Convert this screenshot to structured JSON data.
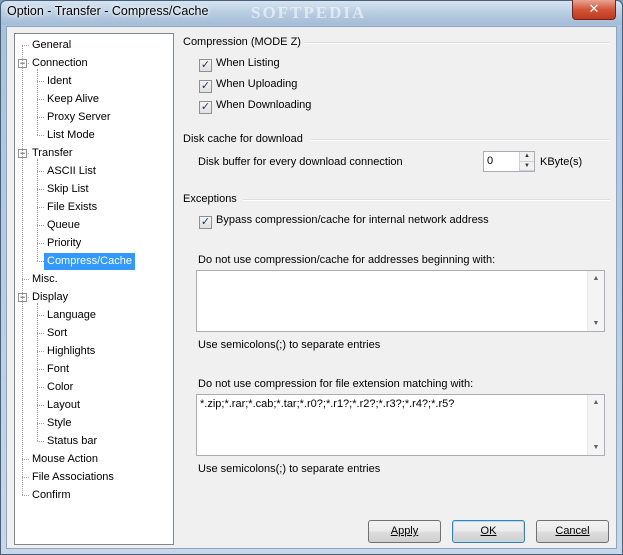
{
  "window": {
    "title": "Option - Transfer - Compress/Cache",
    "watermark": "SOFTPEDIA",
    "close_glyph": "✕"
  },
  "tree": {
    "items": [
      {
        "label": "General",
        "level": 0
      },
      {
        "label": "Connection",
        "level": 0,
        "toggle": "−"
      },
      {
        "label": "Ident",
        "level": 1
      },
      {
        "label": "Keep Alive",
        "level": 1
      },
      {
        "label": "Proxy Server",
        "level": 1
      },
      {
        "label": "List Mode",
        "level": 1
      },
      {
        "label": "Transfer",
        "level": 0,
        "toggle": "−"
      },
      {
        "label": "ASCII List",
        "level": 1
      },
      {
        "label": "Skip List",
        "level": 1
      },
      {
        "label": "File Exists",
        "level": 1
      },
      {
        "label": "Queue",
        "level": 1
      },
      {
        "label": "Priority",
        "level": 1
      },
      {
        "label": "Compress/Cache",
        "level": 1,
        "selected": true
      },
      {
        "label": "Misc.",
        "level": 0
      },
      {
        "label": "Display",
        "level": 0,
        "toggle": "−"
      },
      {
        "label": "Language",
        "level": 1
      },
      {
        "label": "Sort",
        "level": 1
      },
      {
        "label": "Highlights",
        "level": 1
      },
      {
        "label": "Font",
        "level": 1
      },
      {
        "label": "Color",
        "level": 1
      },
      {
        "label": "Layout",
        "level": 1
      },
      {
        "label": "Style",
        "level": 1
      },
      {
        "label": "Status bar",
        "level": 1
      },
      {
        "label": "Mouse Action",
        "level": 0
      },
      {
        "label": "File Associations",
        "level": 0
      },
      {
        "label": "Confirm",
        "level": 0
      }
    ]
  },
  "compression": {
    "title": "Compression (MODE Z)",
    "when_listing": "When Listing",
    "when_uploading": "When Uploading",
    "when_downloading": "When Downloading",
    "check_glyph": "✓"
  },
  "disk_cache": {
    "title": "Disk cache for download",
    "buffer_label": "Disk buffer for every download connection",
    "buffer_value": "0",
    "unit": "KByte(s)",
    "up_glyph": "▲",
    "down_glyph": "▼"
  },
  "exceptions": {
    "title": "Exceptions",
    "bypass_label": "Bypass compression/cache for internal network address",
    "addresses_label": "Do not use compression/cache for addresses beginning with:",
    "addresses_value": "",
    "addresses_hint": "Use semicolons(;) to separate entries",
    "ext_label": "Do not use compression for file extension matching with:",
    "ext_value": "*.zip;*.rar;*.cab;*.tar;*.r0?;*.r1?;*.r2?;*.r3?;*.r4?;*.r5?",
    "ext_hint": "Use semicolons(;) to separate entries"
  },
  "buttons": {
    "apply": "Apply",
    "ok": "OK",
    "cancel": "Cancel"
  }
}
